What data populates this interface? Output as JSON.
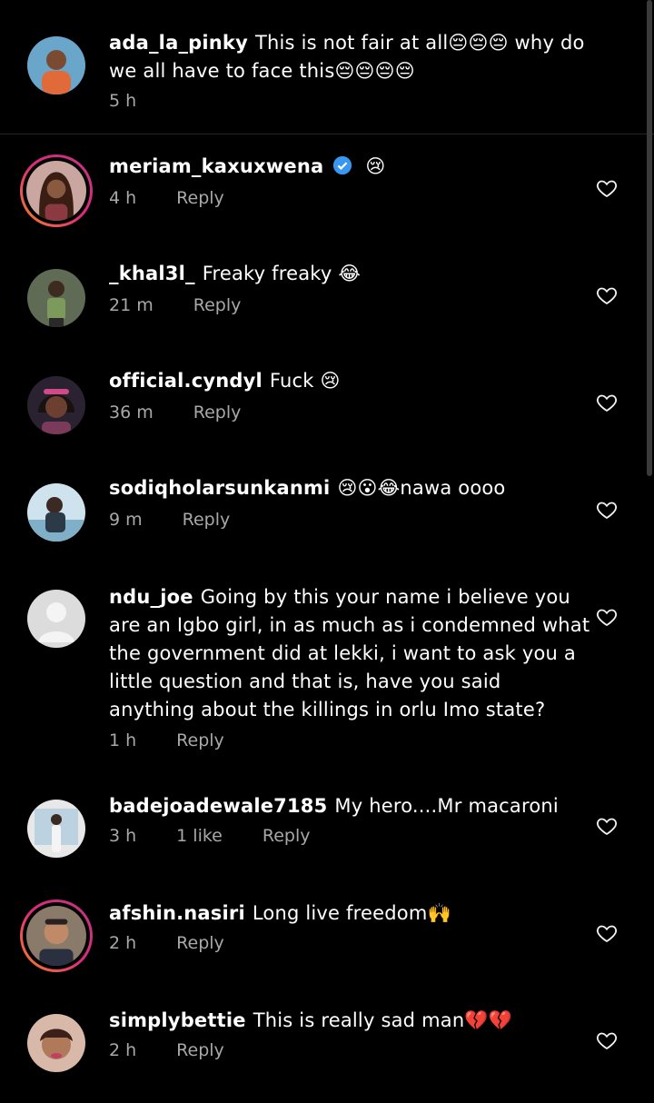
{
  "comments": [
    {
      "user": "ada_la_pinky",
      "text": "This is not fair at all😔😔😔 why do we all have to face this😔😔😔😔",
      "time": "5 h",
      "reply": ""
    },
    {
      "user": "meriam_kaxuxwena",
      "text": "😢",
      "time": "4 h",
      "reply": "Reply"
    },
    {
      "user": "_khal3l_",
      "text": "Freaky freaky 😂",
      "time": "21 m",
      "reply": "Reply"
    },
    {
      "user": "official.cyndyl",
      "text": "Fuck 😢",
      "time": "36 m",
      "reply": "Reply"
    },
    {
      "user": "sodiqholarsunkanmi",
      "text": "😢😮😂nawa oooo",
      "time": "9 m",
      "reply": "Reply"
    },
    {
      "user": "ndu_joe",
      "text": "Going by this your name i believe you are an Igbo girl, in as much as i condemned what the government did at lekki, i want to ask you a little question and that is, have you said anything about the killings in orlu Imo state?",
      "time": "1 h",
      "reply": "Reply"
    },
    {
      "user": "badejoadewale7185",
      "text": "My hero....Mr macaroni",
      "time": "3 h",
      "likes": "1 like",
      "reply": "Reply"
    },
    {
      "user": "afshin.nasiri",
      "text": "Long live freedom🙌",
      "time": "2 h",
      "reply": "Reply"
    },
    {
      "user": "simplybettie",
      "text": "This is really sad man💔💔",
      "time": "2 h",
      "reply": "Reply"
    }
  ],
  "colors": {
    "background": "#000000",
    "meta": "#a8a8a8",
    "verified": "#3897f0",
    "story_ring": "#dd2a7b"
  }
}
